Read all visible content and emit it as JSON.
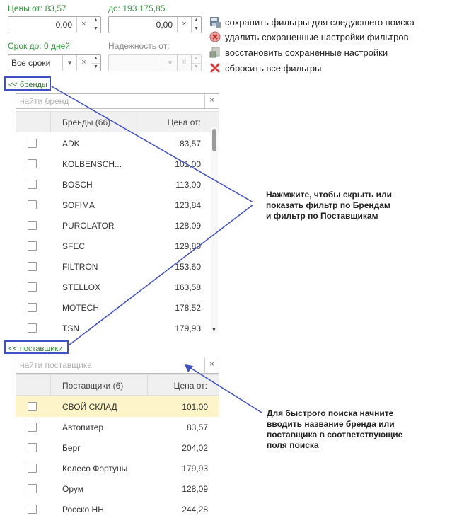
{
  "filters": {
    "price_from_label": "Цены от: 83,57",
    "price_from_value": "0,00",
    "price_to_label": "до: 193 175,85",
    "price_to_value": "0,00",
    "term_label": "Срок до: 0 дней",
    "term_value": "Все сроки",
    "reliability_label": "Надежность от:",
    "reliability_value": ""
  },
  "actions": [
    {
      "label": "сохранить фильтры для следующего поиска",
      "icon": "save-filter-icon"
    },
    {
      "label": "удалить сохраненные настройки фильтров",
      "icon": "delete-circle-icon"
    },
    {
      "label": "восстановить сохраненные настройки",
      "icon": "restore-icon"
    },
    {
      "label": "сбросить все фильтры",
      "icon": "reset-x-icon"
    }
  ],
  "brands": {
    "toggle_link": "<< бренды",
    "search_placeholder": "найти бренд",
    "col_name": "Бренды (66)",
    "col_price": "Цена от:",
    "rows": [
      {
        "name": "ADK",
        "price": "83,57"
      },
      {
        "name": "KOLBENSCH...",
        "price": "101,00"
      },
      {
        "name": "BOSCH",
        "price": "113,00"
      },
      {
        "name": "SOFIMA",
        "price": "123,84"
      },
      {
        "name": "PUROLATOR",
        "price": "128,09"
      },
      {
        "name": "SFEC",
        "price": "129,80"
      },
      {
        "name": "FILTRON",
        "price": "153,60"
      },
      {
        "name": "STELLOX",
        "price": "163,58"
      },
      {
        "name": "MOTECH",
        "price": "178,52"
      },
      {
        "name": "TSN",
        "price": "179,93"
      }
    ]
  },
  "suppliers": {
    "toggle_link": "<< поставщики",
    "search_placeholder": "найти поставщика",
    "col_name": "Поставщики (6)",
    "col_price": "Цена от:",
    "rows": [
      {
        "name": "СВОЙ СКЛАД",
        "price": "101,00"
      },
      {
        "name": "Автопитер",
        "price": "83,57"
      },
      {
        "name": "Берг",
        "price": "204,02"
      },
      {
        "name": "Колесо Фортуны",
        "price": "179,93"
      },
      {
        "name": "Орум",
        "price": "128,09"
      },
      {
        "name": "Росско НН",
        "price": "244,28"
      }
    ]
  },
  "callouts": {
    "toggle_hint": "Нажмжите, чтобы скрыть или\nпоказать фильтр по Брендам\nи фильтр по Поставщикам",
    "search_hint": "Для быстрого поиска начните\nвводить название бренда или\nпоставщика в соответствующие\nполя поиска"
  },
  "colors": {
    "label_green": "#2e9a3a",
    "annotation_blue": "#3f4fc4",
    "selected_row": "#fdf5c9"
  }
}
